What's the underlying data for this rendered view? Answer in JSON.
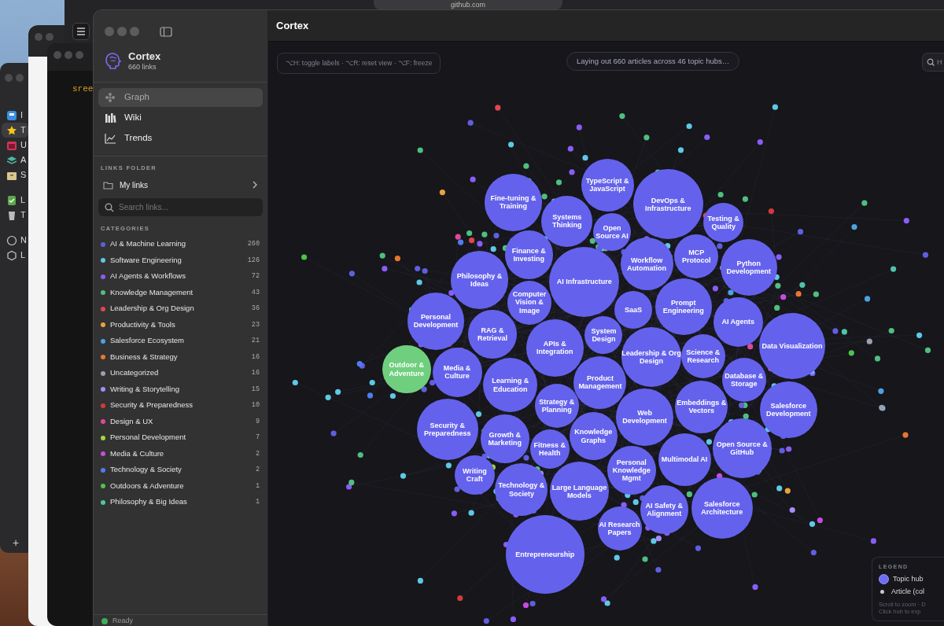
{
  "desktop": {
    "browser": {
      "url": "github.com"
    },
    "terminal": {
      "text": "sree"
    },
    "left_window": {
      "items": [
        {
          "label": "I",
          "selected": false
        },
        {
          "label": "T",
          "selected": true
        },
        {
          "label": "U",
          "selected": false
        },
        {
          "label": "A",
          "selected": false
        },
        {
          "label": "S",
          "selected": false
        },
        {
          "label": "L",
          "selected": false
        },
        {
          "label": "T",
          "selected": false
        },
        {
          "label": "N",
          "selected": false
        },
        {
          "label": "L",
          "selected": false
        }
      ],
      "add_label": "+"
    }
  },
  "sidebar": {
    "brand": {
      "title": "Cortex",
      "subtitle": "660 links"
    },
    "nav": [
      {
        "label": "Graph",
        "selected": true
      },
      {
        "label": "Wiki",
        "selected": false
      },
      {
        "label": "Trends",
        "selected": false
      }
    ],
    "links_folder": {
      "heading": "LINKS FOLDER",
      "folder": "My links"
    },
    "search": {
      "placeholder": "Search links..."
    },
    "categories_heading": "CATEGORIES",
    "categories": [
      {
        "name": "AI & Machine Learning",
        "count": "260",
        "color": "#5f5fe0"
      },
      {
        "name": "Software Engineering",
        "count": "126",
        "color": "#5ec8e6"
      },
      {
        "name": "AI Agents & Workflows",
        "count": "72",
        "color": "#8b5cf6"
      },
      {
        "name": "Knowledge Management",
        "count": "43",
        "color": "#4fbf7f"
      },
      {
        "name": "Leadership & Org Design",
        "count": "36",
        "color": "#e0474c"
      },
      {
        "name": "Productivity & Tools",
        "count": "23",
        "color": "#e9a33a"
      },
      {
        "name": "Salesforce Ecosystem",
        "count": "21",
        "color": "#4aa3df"
      },
      {
        "name": "Business & Strategy",
        "count": "16",
        "color": "#e8772e"
      },
      {
        "name": "Uncategorized",
        "count": "16",
        "color": "#9aa0b2"
      },
      {
        "name": "Writing & Storytelling",
        "count": "15",
        "color": "#a78bfa"
      },
      {
        "name": "Security & Preparedness",
        "count": "10",
        "color": "#d23a3a"
      },
      {
        "name": "Design & UX",
        "count": "9",
        "color": "#e0479a"
      },
      {
        "name": "Personal Development",
        "count": "7",
        "color": "#a3d63a"
      },
      {
        "name": "Media & Culture",
        "count": "2",
        "color": "#c84be0"
      },
      {
        "name": "Technology & Society",
        "count": "2",
        "color": "#4f7cf0"
      },
      {
        "name": "Outdoors & Adventure",
        "count": "1",
        "color": "#4cc44c"
      },
      {
        "name": "Philosophy & Big Ideas",
        "count": "1",
        "color": "#4fc4a8"
      }
    ],
    "status": "Ready"
  },
  "main": {
    "title": "Cortex",
    "shortcuts": "⌥H: toggle labels · ⌥R: reset view · ⌥F: freeze",
    "progress": "Laying out 660 articles across 46 topic hubs…",
    "search": {
      "placeholder": "H"
    },
    "hubs": [
      {
        "label": "Fine-tuning & Training",
        "color": "#6462ec"
      },
      {
        "label": "TypeScript & JavaScript",
        "color": "#6462ec"
      },
      {
        "label": "DevOps & Infrastructure",
        "color": "#6462ec"
      },
      {
        "label": "Systems Thinking",
        "color": "#6462ec"
      },
      {
        "label": "Testing & Quality",
        "color": "#6462ec"
      },
      {
        "label": "MCP Protocol",
        "color": "#6462ec"
      },
      {
        "label": "Philosophy & Ideas",
        "color": "#6462ec"
      },
      {
        "label": "Finance & Investing",
        "color": "#6462ec"
      },
      {
        "label": "Open Source AI",
        "color": "#6462ec"
      },
      {
        "label": "AI Infrastructure",
        "color": "#6462ec"
      },
      {
        "label": "Computer Vision & Image",
        "color": "#6462ec"
      },
      {
        "label": "Workflow Automation",
        "color": "#6462ec"
      },
      {
        "label": "Python Development",
        "color": "#6462ec"
      },
      {
        "label": "Data Visualization",
        "color": "#6462ec"
      },
      {
        "label": "RAG & Retrieval",
        "color": "#6462ec"
      },
      {
        "label": "Personal Development",
        "color": "#6462ec"
      },
      {
        "label": "Outdoor & Adventure",
        "color": "#6fcf7f"
      },
      {
        "label": "System Design",
        "color": "#6462ec"
      },
      {
        "label": "SaaS",
        "color": "#6462ec"
      },
      {
        "label": "Prompt Engineering",
        "color": "#6462ec"
      },
      {
        "label": "Leadership & Org Design",
        "color": "#6462ec"
      },
      {
        "label": "Science & Research",
        "color": "#6462ec"
      },
      {
        "label": "AI Agents",
        "color": "#6462ec"
      },
      {
        "label": "APIs & Integration",
        "color": "#6462ec"
      },
      {
        "label": "Product Management",
        "color": "#6462ec"
      },
      {
        "label": "Database & Storage",
        "color": "#6462ec"
      },
      {
        "label": "Knowledge Graphs",
        "color": "#6462ec"
      },
      {
        "label": "Embeddings & Vectors",
        "color": "#6462ec"
      },
      {
        "label": "Learning & Education",
        "color": "#6462ec"
      },
      {
        "label": "Strategy & Planning",
        "color": "#6462ec"
      },
      {
        "label": "Media & Culture",
        "color": "#6462ec"
      },
      {
        "label": "Fitness & Health",
        "color": "#6462ec"
      },
      {
        "label": "Growth & Marketing",
        "color": "#6462ec"
      },
      {
        "label": "Salesforce Development",
        "color": "#6462ec"
      },
      {
        "label": "Open Source & GitHub",
        "color": "#6462ec"
      },
      {
        "label": "Web Development",
        "color": "#6462ec"
      },
      {
        "label": "Security & Preparedness",
        "color": "#6462ec"
      },
      {
        "label": "Technology & Society",
        "color": "#6462ec"
      },
      {
        "label": "Large Language Models",
        "color": "#6462ec"
      },
      {
        "label": "Multimodal AI",
        "color": "#6462ec"
      },
      {
        "label": "Writing Craft",
        "color": "#6462ec"
      },
      {
        "label": "Personal Knowledge Mgmt",
        "color": "#6462ec"
      },
      {
        "label": "AI Safety & Alignment",
        "color": "#6462ec"
      },
      {
        "label": "AI Research Papers",
        "color": "#6462ec"
      },
      {
        "label": "Salesforce Architecture",
        "color": "#6462ec"
      },
      {
        "label": "Entrepreneurship",
        "color": "#6462ec"
      }
    ],
    "legend": {
      "heading": "LEGEND",
      "items": [
        {
          "kind": "hub",
          "label": "Topic hub"
        },
        {
          "kind": "article",
          "label": "Article (col"
        }
      ],
      "hints": [
        "Scroll to zoom · D",
        "Click hub to exp"
      ]
    }
  }
}
